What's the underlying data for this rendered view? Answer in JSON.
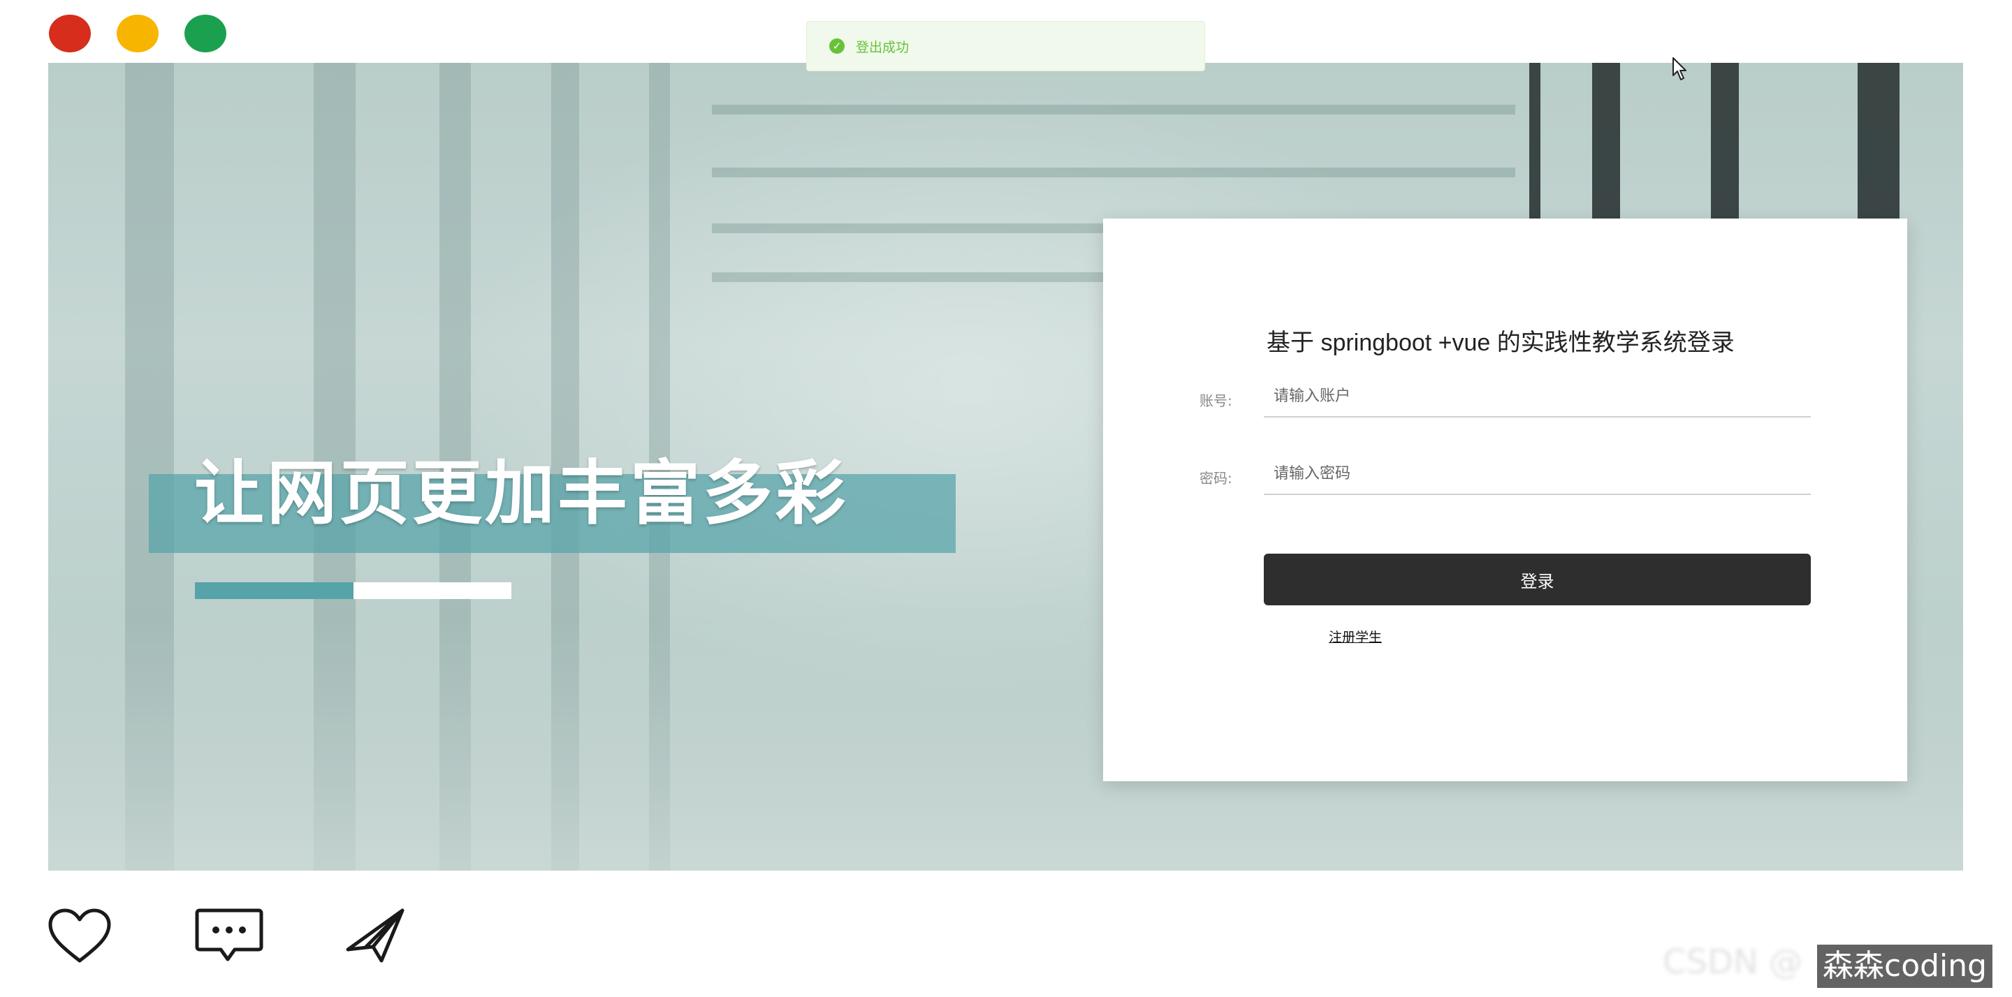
{
  "window": {
    "controls": [
      "close",
      "minimize",
      "maximize"
    ]
  },
  "toast": {
    "icon": "check-circle-icon",
    "message": "登出成功",
    "color": "#67c23a"
  },
  "hero": {
    "headline": "让网页更加丰富多彩",
    "progress_fraction": 0.5,
    "accent_color": "#56a3a9"
  },
  "login": {
    "title": "基于 springboot +vue 的实践性教学系统登录",
    "account_label": "账号:",
    "account_placeholder": "请输入账户",
    "password_label": "密码:",
    "password_placeholder": "请输入密码",
    "login_button": "登录",
    "register_link": "注册学生"
  },
  "social": {
    "icons": [
      "heart-icon",
      "comment-icon",
      "send-icon"
    ]
  },
  "watermark": {
    "text": "森森coding"
  }
}
